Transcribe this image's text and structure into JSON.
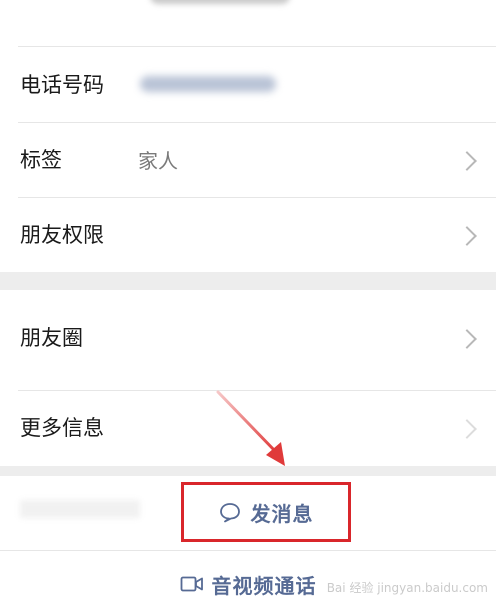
{
  "rows": {
    "phone": {
      "label": "电话号码"
    },
    "tags": {
      "label": "标签",
      "value": "家人"
    },
    "friend_permissions": {
      "label": "朋友权限"
    },
    "moments": {
      "label": "朋友圈"
    },
    "more_info": {
      "label": "更多信息"
    }
  },
  "actions": {
    "send_message": "发消息",
    "video_call": "音视频通话"
  },
  "icons": {
    "chat": "chat-bubble-icon",
    "video": "video-camera-icon",
    "chevron": "chevron-right-icon"
  },
  "colors": {
    "highlight_box": "#d9262b",
    "action_text": "#566a94",
    "arrow": "#e03a3a"
  },
  "watermark": "Bai 经验 jingyan.baidu.com"
}
